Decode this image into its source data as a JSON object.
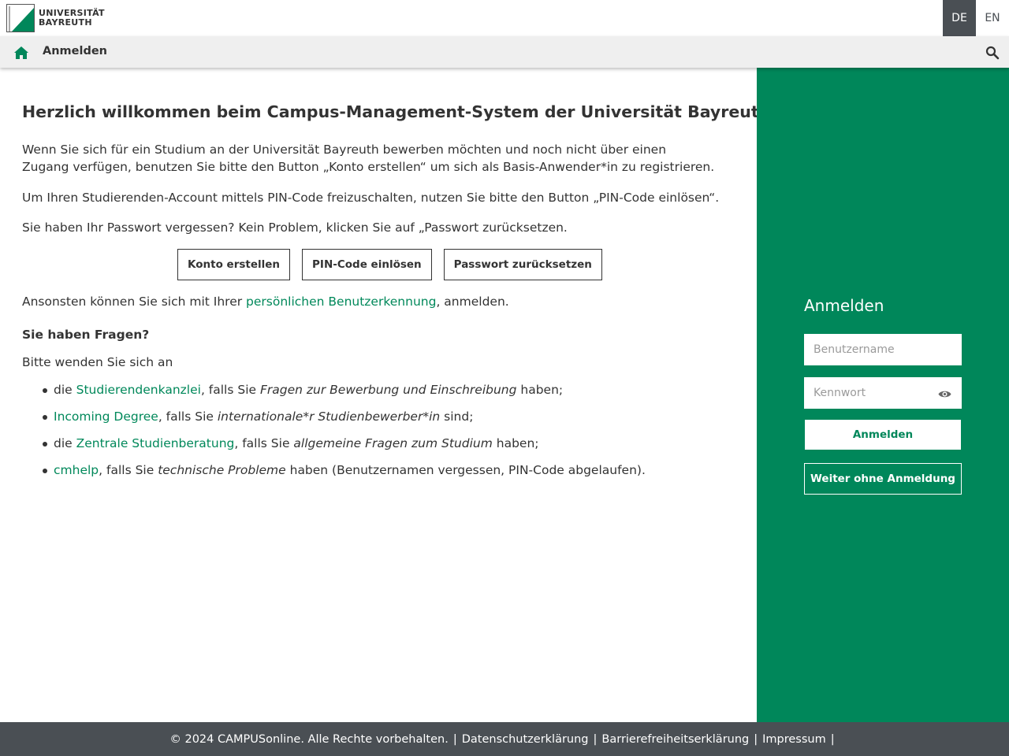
{
  "header": {
    "logo_line1": "UNIVERSITÄT",
    "logo_line2": "BAYREUTH",
    "lang_de": "DE",
    "lang_en": "EN"
  },
  "navbar": {
    "title": "Anmelden",
    "home_icon": "home-icon",
    "search_icon": "search-icon"
  },
  "main": {
    "heading": "Herzlich willkommen beim Campus-Management-System der Universität Bayreuth.",
    "para1": "Wenn Sie sich für ein Studium an der Universität Bayreuth bewerben möchten und noch nicht über einen Zugang verfügen, benutzen Sie bitte den Button „Konto erstellen“ um sich als Basis-Anwender*in zu registrieren.",
    "para2": "Um Ihren Studierenden-Account mittels PIN-Code freizuschalten, nutzen Sie bitte den Button „PIN-Code einlösen“.",
    "para3": "Sie haben Ihr Passwort vergessen? Kein Problem, klicken Sie auf „Passwort zurücksetzen.",
    "buttons": {
      "create_account": "Konto erstellen",
      "redeem_pin": "PIN-Code einlösen",
      "reset_password": "Passwort zurücksetzen"
    },
    "para4_before": "Ansonsten können Sie sich mit Ihrer ",
    "para4_link": "persönlichen Benutzerkennung",
    "para4_after": ", anmelden.",
    "questions_heading": "Sie haben Fragen?",
    "questions_intro": "Bitte wenden Sie sich an",
    "help_items": [
      {
        "pre": "die ",
        "link": "Studierendenkanzlei",
        "mid": ", falls Sie ",
        "em": "Fragen zur Bewerbung und Einschreibung",
        "post": " haben;"
      },
      {
        "pre": "",
        "link": "Incoming Degree",
        "mid": ", falls Sie ",
        "em": "internationale*r Studienbewerber*in",
        "post": " sind;"
      },
      {
        "pre": "die ",
        "link": "Zentrale Studienberatung",
        "mid": ", falls Sie ",
        "em": "allgemeine Fragen zum Studium",
        "post": " haben;"
      },
      {
        "pre": "",
        "link": "cmhelp",
        "mid": ", falls Sie ",
        "em": "technische Probleme",
        "post": " haben (Benutzernamen vergessen, PIN-Code abgelaufen)."
      }
    ]
  },
  "login": {
    "title": "Anmelden",
    "username_placeholder": "Benutzername",
    "password_placeholder": "Kennwort",
    "password_toggle_icon": "eye-icon",
    "submit_label": "Anmelden",
    "guest_label": "Weiter ohne Anmeldung"
  },
  "footer": {
    "copyright": "© 2024 CAMPUSonline. Alle Rechte vorbehalten.",
    "privacy": "Datenschutzerklärung",
    "accessibility": "Barrierefreiheitserklärung",
    "imprint": "Impressum",
    "separator": "|"
  },
  "colors": {
    "accent_green": "#00875a",
    "footer_gray": "#4a4f54",
    "nav_gray": "#efefef"
  }
}
